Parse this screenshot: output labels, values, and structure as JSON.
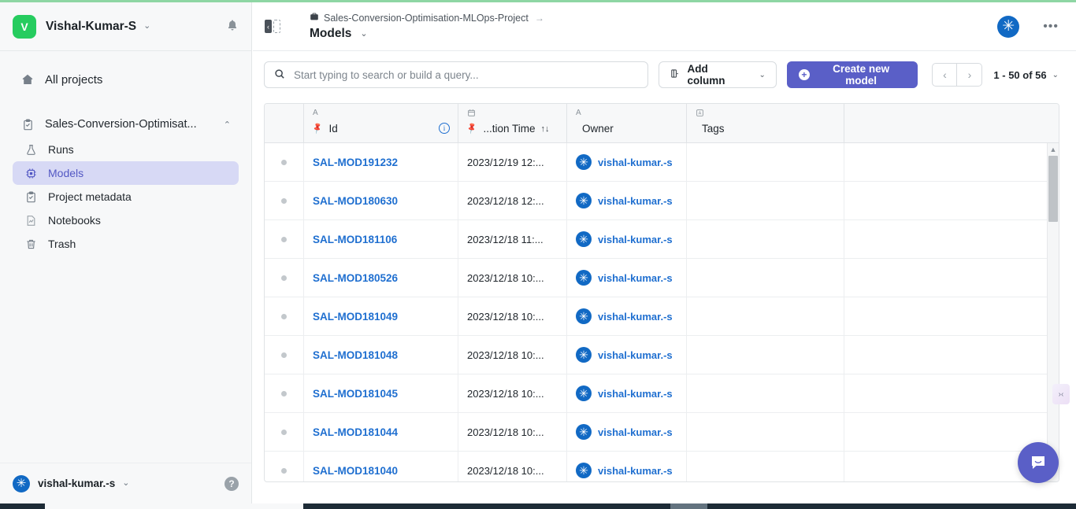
{
  "theme": {
    "accent_purple": "#5a5fc7",
    "accent_blue": "#1f6fd0",
    "avatar_green": "#26cc5f",
    "top_accent_green": "#8ed6a4",
    "sidebar_bg": "#f7f8f9",
    "active_nav_bg": "#d7d9f5"
  },
  "sidebar": {
    "workspace": {
      "avatar_letter": "V",
      "name": "Vishal-Kumar-S",
      "chevron": "⌄",
      "bell_icon": "🔔"
    },
    "all_projects": {
      "label": "All projects",
      "icon": "home-icon"
    },
    "project": {
      "label": "Sales-Conversion-Optimisat...",
      "icon": "clipboard-icon",
      "caret": "⌃"
    },
    "items": [
      {
        "label": "Runs",
        "icon": "flask-icon",
        "active": false
      },
      {
        "label": "Models",
        "icon": "chip-icon",
        "active": true
      },
      {
        "label": "Project metadata",
        "icon": "clipboard-check-icon",
        "active": false
      },
      {
        "label": "Notebooks",
        "icon": "notebook-icon",
        "active": false
      },
      {
        "label": "Trash",
        "icon": "trash-icon",
        "active": false
      }
    ],
    "footer": {
      "username": "vishal-kumar.-s",
      "chevron": "⌄",
      "help_label": "?"
    }
  },
  "topbar": {
    "panel_toggle": "collapse-panel-icon",
    "breadcrumb": {
      "project_icon": "briefcase-icon",
      "project_name": "Sales-Conversion-Optimisation-MLOps-Project",
      "arrow": "→"
    },
    "page_title": "Models",
    "title_chevron": "⌄",
    "more_menu": "•••"
  },
  "toolbar": {
    "search": {
      "placeholder": "Start typing to search or build a query...",
      "value": "",
      "icon": "search-icon"
    },
    "add_column": {
      "label": "Add column",
      "icon": "column-icon",
      "chevron": "⌄"
    },
    "create_button": {
      "label": "Create new model",
      "plus": "+"
    },
    "pager": {
      "prev": "‹",
      "next": "›",
      "range_label": "1 - 50 of 56",
      "chevron": "⌄"
    }
  },
  "table": {
    "columns": [
      {
        "key": "marker",
        "label": "",
        "type_icon": "",
        "pin": false,
        "sort": "",
        "info": false
      },
      {
        "key": "id",
        "label": "Id",
        "type_icon": "A",
        "pin": true,
        "sort": "",
        "info": true
      },
      {
        "key": "time",
        "label": "...tion Time",
        "type_icon": "📅",
        "pin": true,
        "sort": "↑↓",
        "info": false
      },
      {
        "key": "owner",
        "label": "Owner",
        "type_icon": "A",
        "pin": false,
        "sort": "",
        "info": false
      },
      {
        "key": "tags",
        "label": "Tags",
        "type_icon": "A",
        "pin": false,
        "sort": "",
        "info": false
      },
      {
        "key": "rest",
        "label": "",
        "type_icon": "",
        "pin": false,
        "sort": "",
        "info": false
      }
    ],
    "rows": [
      {
        "id": "SAL-MOD191232",
        "time": "2023/12/19 12:...",
        "owner": "vishal-kumar.-s",
        "tags": ""
      },
      {
        "id": "SAL-MOD180630",
        "time": "2023/12/18 12:...",
        "owner": "vishal-kumar.-s",
        "tags": ""
      },
      {
        "id": "SAL-MOD181106",
        "time": "2023/12/18 11:...",
        "owner": "vishal-kumar.-s",
        "tags": ""
      },
      {
        "id": "SAL-MOD180526",
        "time": "2023/12/18 10:...",
        "owner": "vishal-kumar.-s",
        "tags": ""
      },
      {
        "id": "SAL-MOD181049",
        "time": "2023/12/18 10:...",
        "owner": "vishal-kumar.-s",
        "tags": ""
      },
      {
        "id": "SAL-MOD181048",
        "time": "2023/12/18 10:...",
        "owner": "vishal-kumar.-s",
        "tags": ""
      },
      {
        "id": "SAL-MOD181045",
        "time": "2023/12/18 10:...",
        "owner": "vishal-kumar.-s",
        "tags": ""
      },
      {
        "id": "SAL-MOD181044",
        "time": "2023/12/18 10:...",
        "owner": "vishal-kumar.-s",
        "tags": ""
      },
      {
        "id": "SAL-MOD181040",
        "time": "2023/12/18 10:...",
        "owner": "vishal-kumar.-s",
        "tags": ""
      }
    ]
  },
  "overlays": {
    "collapse_handle": "›‹",
    "chat_button": "chat-bubble-icon"
  }
}
